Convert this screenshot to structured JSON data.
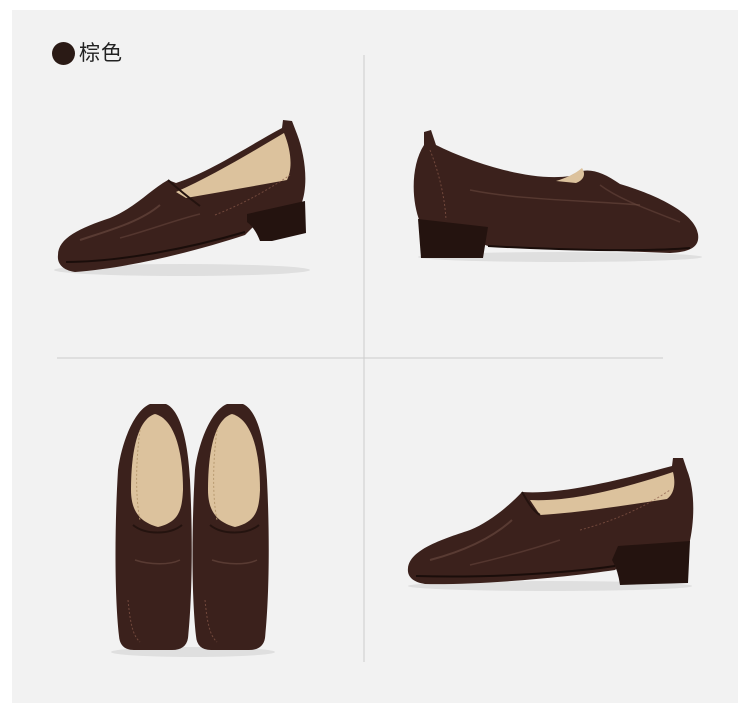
{
  "label": {
    "color_name": "棕色"
  },
  "icons": {
    "swatch": "color-swatch-icon"
  },
  "colors": {
    "frame": "#ffffff",
    "panel": "#f2f2f2",
    "swatch": "#2a1a15",
    "leather": "#3b211c",
    "leather_dark": "#24130f",
    "leather_highlight": "#6e4c42",
    "lining": "#dcc29d",
    "divider": "#cccccc"
  }
}
